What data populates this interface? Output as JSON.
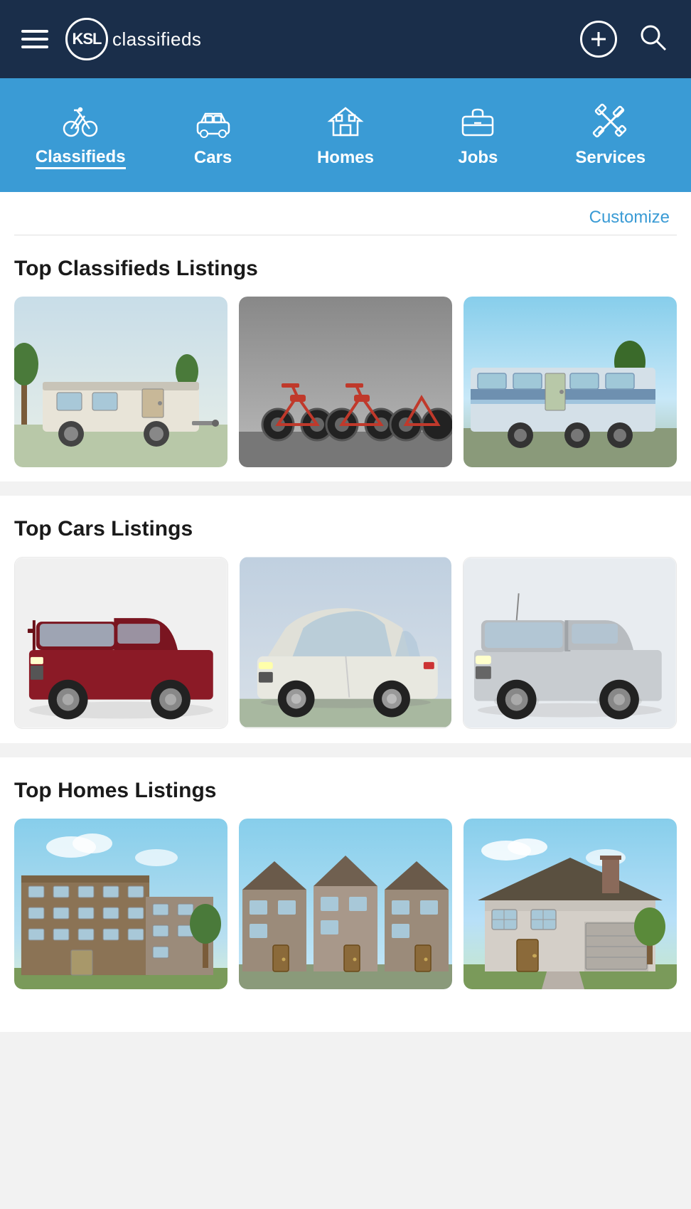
{
  "header": {
    "logo_ksl": "KSL",
    "logo_subtitle": "classifieds",
    "menu_icon": "menu",
    "add_icon": "add",
    "search_icon": "search"
  },
  "nav": {
    "items": [
      {
        "id": "classifieds",
        "label": "Classifieds",
        "icon": "bicycle",
        "active": true
      },
      {
        "id": "cars",
        "label": "Cars",
        "icon": "car",
        "active": false
      },
      {
        "id": "homes",
        "label": "Homes",
        "icon": "home",
        "active": false
      },
      {
        "id": "jobs",
        "label": "Jobs",
        "icon": "briefcase",
        "active": false
      },
      {
        "id": "services",
        "label": "Services",
        "icon": "tools",
        "active": false
      }
    ]
  },
  "customize": {
    "label": "Customize"
  },
  "sections": [
    {
      "id": "classifieds",
      "title": "Top Classifieds Listings",
      "listings": [
        {
          "id": "rv1",
          "type": "rv",
          "description": "RV camper trailer"
        },
        {
          "id": "bikes",
          "type": "motorcycles",
          "description": "Multiple dirt bikes"
        },
        {
          "id": "rv2",
          "type": "rv-large",
          "description": "Large travel trailer"
        }
      ]
    },
    {
      "id": "cars",
      "title": "Top Cars Listings",
      "listings": [
        {
          "id": "truck-red",
          "type": "pickup-truck-red",
          "description": "Red GMC Sierra"
        },
        {
          "id": "car-white",
          "type": "sedan-white",
          "description": "White Kia sedan"
        },
        {
          "id": "truck-silver",
          "type": "pickup-truck-silver",
          "description": "Silver Ford F-150"
        }
      ]
    },
    {
      "id": "homes",
      "title": "Top Homes Listings",
      "listings": [
        {
          "id": "apt",
          "type": "apartment",
          "description": "Brick apartment complex"
        },
        {
          "id": "townhouse",
          "type": "townhouse",
          "description": "Stone townhouse"
        },
        {
          "id": "house",
          "type": "house",
          "description": "Suburban house"
        }
      ]
    }
  ]
}
